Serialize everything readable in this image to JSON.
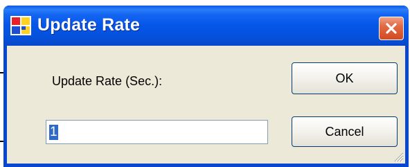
{
  "window": {
    "title": "Update Rate",
    "close_symbol": "✕"
  },
  "dialog": {
    "label": "Update Rate (Sec.):",
    "input_value": "1",
    "ok_label": "OK",
    "cancel_label": "Cancel"
  },
  "icons": {
    "app": "app-icon",
    "close": "close-icon",
    "grip": "resize-grip-icon"
  },
  "colors": {
    "titlebar": "#0556e8",
    "client": "#ece9d8",
    "close_button": "#d24a22",
    "selection": "#316ac5"
  }
}
